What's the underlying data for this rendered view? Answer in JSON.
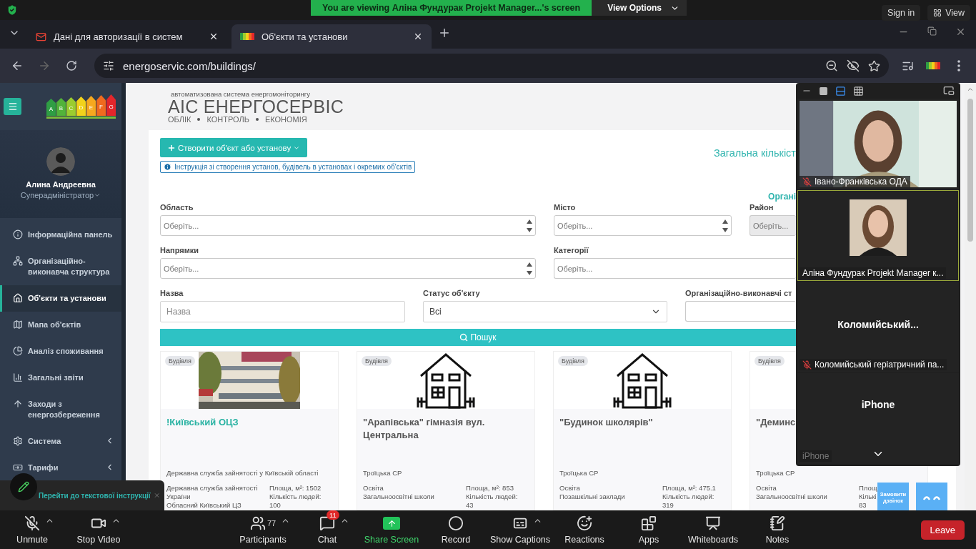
{
  "meeting_banner": {
    "text": "You are viewing Аліна Фундурак Projekt Manager...'s screen",
    "view_options": "View Options",
    "sign_in": "Sign in",
    "view": "View"
  },
  "browser": {
    "tabs": [
      {
        "title": "Дані для авторизації в систем",
        "selected": false
      },
      {
        "title": "Об'єкти та установи",
        "selected": true
      }
    ],
    "url": "energoservic.com/buildings/"
  },
  "sidebar": {
    "energy_classes": [
      {
        "letter": "A",
        "color": "#2f9e44"
      },
      {
        "letter": "B",
        "color": "#52b33a"
      },
      {
        "letter": "C",
        "color": "#9ccc2f"
      },
      {
        "letter": "D",
        "color": "#f2d21b"
      },
      {
        "letter": "E",
        "color": "#f6a81e"
      },
      {
        "letter": "F",
        "color": "#f06a1e"
      },
      {
        "letter": "G",
        "color": "#e3262b"
      }
    ],
    "user": {
      "name": "Алина Андреевна",
      "role": "Суперадміністратор"
    },
    "items": [
      {
        "label": "Інформаційна панель",
        "selected": false,
        "submenu": false
      },
      {
        "label": "Організаційно-виконавча структура",
        "selected": false,
        "submenu": false
      },
      {
        "label": "Об'єкти та установи",
        "selected": true,
        "submenu": false
      },
      {
        "label": "Мапа об'єктів",
        "selected": false,
        "submenu": false
      },
      {
        "label": "Аналіз споживання",
        "selected": false,
        "submenu": false
      },
      {
        "label": "Загальні звіти",
        "selected": false,
        "submenu": false
      },
      {
        "label": "Заходи з енергозбереження",
        "selected": false,
        "submenu": false
      },
      {
        "label": "Система",
        "selected": false,
        "submenu": true
      },
      {
        "label": "Тарифи",
        "selected": false,
        "submenu": true
      }
    ]
  },
  "header": {
    "caption": "автоматизована система енергомоніторингу",
    "title": "АІС ЕНЕРГОСЕРВІС",
    "tagline": [
      "ОБЛІК",
      "КОНТРОЛЬ",
      "ЕКОНОМІЯ"
    ]
  },
  "actions": {
    "create_button": "Створити об'єкт або установу",
    "instruction_link": "Інструкція зі створення установ, будівель в установах і окремих об'єктів",
    "total_label": "Загальна кількіст",
    "org_label": "Органі"
  },
  "filter_rows": [
    [
      {
        "label": "Область",
        "placeholder": "Оберіть...",
        "kind": "multi",
        "disabled": false
      },
      {
        "label": "Місто",
        "placeholder": "Оберіть...",
        "kind": "multi",
        "disabled": false
      },
      {
        "label": "Район",
        "placeholder": "Оберіть...",
        "kind": "cut",
        "disabled": true
      }
    ],
    [
      {
        "label": "Напрямки",
        "placeholder": "Оберіть...",
        "kind": "multi",
        "disabled": false
      },
      {
        "label": "Категорії",
        "placeholder": "Оберіть...",
        "kind": "cut",
        "disabled": false
      }
    ],
    [
      {
        "label": "Назва",
        "placeholder": "Назва",
        "kind": "text",
        "disabled": false
      },
      {
        "label": "Статус об'єкту",
        "value": "Всі",
        "kind": "select",
        "disabled": false
      },
      {
        "label": "Організаційно-виконавчі ст",
        "kind": "cut",
        "disabled": false
      }
    ]
  ],
  "search_button": "Пошук",
  "cards": [
    {
      "tag": "Будівля",
      "kind": "picture",
      "title": "!Київський ОЦЗ",
      "highlighted": true,
      "organization": "Державна служба зайнятості у Київській області",
      "category": "Державна служба зайнятості України",
      "subcategory": "Обласний Київський ЦЗ",
      "area": "Площа, м²: 1502",
      "people": "Кількість людей:",
      "people_value": "100"
    },
    {
      "tag": "Будівля",
      "kind": "house",
      "title": "\"Арапівська\" гімназія вул. Центральна",
      "highlighted": false,
      "organization": "Троїцька СР",
      "category": "Освіта",
      "subcategory": "Загальноосвітні школи",
      "area": "Площа, м²: 853",
      "people": "Кількість людей:",
      "people_value": "43"
    },
    {
      "tag": "Будівля",
      "kind": "house",
      "title": "\"Будинок школярів\"",
      "highlighted": false,
      "organization": "Троїцька СР",
      "category": "Освіта",
      "subcategory": "Позашкільні заклади",
      "area": "Площа, м²: 475.1",
      "people": "Кількість людей:",
      "people_value": "319"
    },
    {
      "tag": "Будівля",
      "kind": "blank",
      "title": "\"Деминс",
      "highlighted": false,
      "organization": "Троїцька СР",
      "category": "Освіта",
      "subcategory": "Загальноосвітні школи",
      "area": "Площ",
      "people": "Кількі",
      "people_value": "83"
    }
  ],
  "instruction_popup": "Перейти до текстової інструкції",
  "call_button": "Замовити дзвінок",
  "meeting_panel": {
    "tiles": [
      {
        "kind": "video",
        "name": "Івано-Франківська ОДА",
        "muted": true,
        "active": false,
        "dimmed": false
      },
      {
        "name": "Аліна Фундурак Projekt Manager к...",
        "muted": false,
        "active": true,
        "dimmed": false
      },
      {
        "kind": "name",
        "display": "Коломийський...",
        "name": "Коломийський геріатричний па...",
        "muted": true,
        "active": false,
        "dimmed": false
      },
      {
        "kind": "name",
        "display": "iPhone",
        "name": "iPhone",
        "muted": false,
        "active": false,
        "dimmed": true
      }
    ]
  },
  "meeting_toolbar": {
    "left": [
      {
        "label": "Unmute",
        "caret": true
      },
      {
        "label": "Stop Video",
        "caret": true
      }
    ],
    "center": [
      {
        "label": "Participants",
        "count": "77",
        "caret": true
      },
      {
        "label": "Chat",
        "badge": "11",
        "caret": true
      },
      {
        "label": "Share Screen",
        "caret": false
      },
      {
        "label": "Record",
        "caret": false
      },
      {
        "label": "Show Captions",
        "caret": true
      },
      {
        "label": "Reactions",
        "caret": false
      },
      {
        "label": "Apps",
        "caret": false
      },
      {
        "label": "Whiteboards",
        "caret": false
      },
      {
        "label": "Notes",
        "caret": false
      }
    ],
    "leave": "Leave"
  }
}
